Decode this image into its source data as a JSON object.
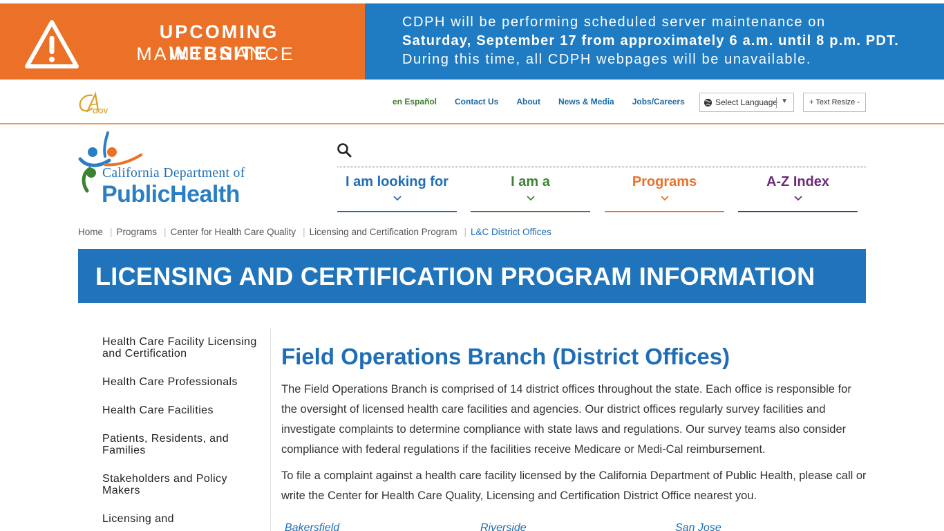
{
  "banner": {
    "title_line1": "UPCOMING WEBSITE",
    "title_line2": "MAINTENANCE",
    "line1": "CDPH will be performing scheduled server maintenance on",
    "line2": "Saturday, September 17 from approximately 6 a.m. until 8 p.m. PDT.",
    "line3": "During this time, all CDPH webpages will be unavailable.",
    "colors": {
      "left": "#ec7128",
      "right": "#1f7bc2"
    }
  },
  "utility": {
    "links": [
      {
        "label": "en Español",
        "name": "link-en-espanol"
      },
      {
        "label": "Contact Us",
        "name": "link-contact-us"
      },
      {
        "label": "About",
        "name": "link-about"
      },
      {
        "label": "News & Media",
        "name": "link-news-media"
      },
      {
        "label": "Jobs/Careers",
        "name": "link-jobs-careers"
      }
    ],
    "language_label": "Select Language",
    "text_resize_label": "+ Text Resize -"
  },
  "logo": {
    "subtitle": "California Department of",
    "main": "PublicHealth",
    "cagov_text": "GOV"
  },
  "nav": {
    "items": [
      {
        "label": "I am looking for",
        "color": "#1f6db5"
      },
      {
        "label": "I am a",
        "color": "#3d8233"
      },
      {
        "label": "Programs",
        "color": "#e8722a"
      },
      {
        "label": "A-Z Index",
        "color": "#6c2a7c"
      }
    ]
  },
  "breadcrumb": {
    "items": [
      "Home",
      "Programs",
      "Center for Health Care Quality",
      "Licensing and Certification Program"
    ],
    "current": "L&C District Offices"
  },
  "page_title": "LICENSING AND CERTIFICATION PROGRAM INFORMATION",
  "sidebar": {
    "items": [
      "Health Care Facility Licensing and Certification",
      "Health Care Professionals",
      "Health Care Facilities",
      "Patients, Residents, and Families",
      "Stakeholders and Policy Makers",
      "Licensing and"
    ]
  },
  "main": {
    "heading": "Field Operations Branch (District Offices)",
    "paragraph1": "The Field Operations Branch is comprised of 14 district offices throughout the state. Each office is responsible for the oversight of licensed health care facilities and agencies. Our district offices regularly survey facilities and investigate complaints to determine compliance with state laws and regulations. Our survey teams also consider compliance with federal regulations if the facilities receive Medicare or Medi-Cal reimbursement.",
    "paragraph2": "To file a complaint against a health care facility licensed by the California Department of Public Health, please call or write the Center for Health Care Quality, Licensing and Certification District Office nearest you.",
    "cities": [
      "Bakersfield",
      "Riverside",
      "San Jose"
    ]
  }
}
